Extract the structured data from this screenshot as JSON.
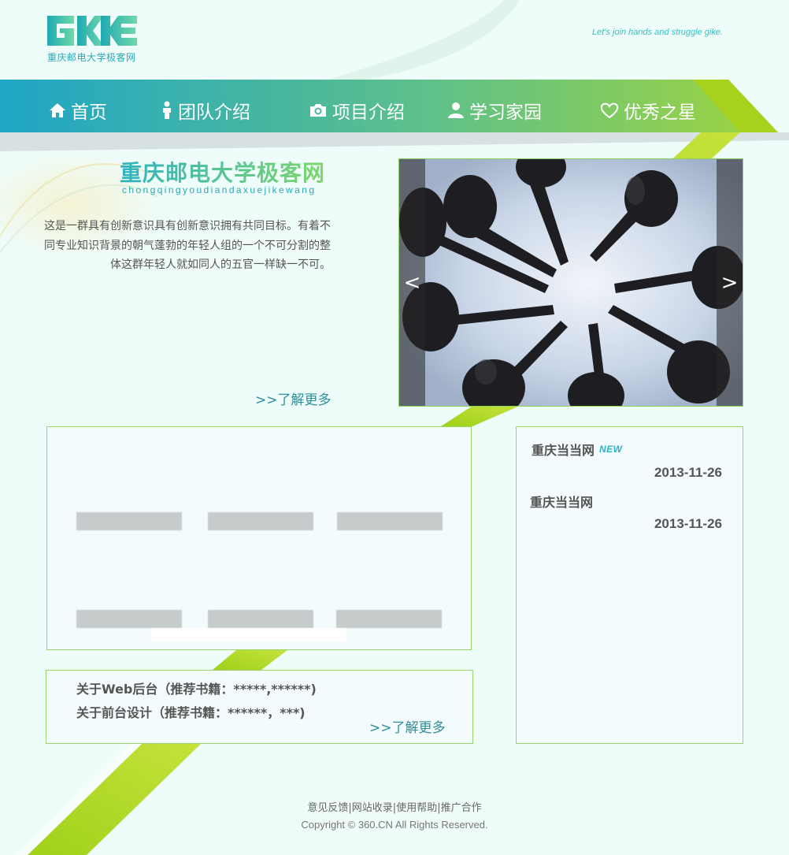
{
  "header": {
    "logo_text": "GKE",
    "logo_subtitle": "重庆邮电大学极客网",
    "slogan": "Let's join hands and struggle gike."
  },
  "nav": {
    "items": [
      {
        "label": "首页",
        "icon": "home-icon"
      },
      {
        "label": "团队介绍",
        "icon": "person-icon"
      },
      {
        "label": "项目介绍",
        "icon": "camera-icon"
      },
      {
        "label": "学习家园",
        "icon": "user-icon"
      },
      {
        "label": "优秀之星",
        "icon": "heart-icon"
      }
    ]
  },
  "hero": {
    "title": "重庆邮电大学极客网",
    "pinyin": "chongqingyoudiandaxuejikewang",
    "description": "这是一群具有创新意识具有创新意识拥有共同目标。有着不同专业知识背景的朝气蓬勃的年轻人组的一个不可分割的整体这群年轻人就如同人的五官一样缺一不可。",
    "more_link": ">>了解更多"
  },
  "slider": {
    "prev": "<",
    "next": ">"
  },
  "books": {
    "lines": [
      "关于Web后台（推荐书籍：*****,******)",
      "关于前台设计（推荐书籍：******，***)"
    ],
    "more_link": ">>了解更多"
  },
  "news": {
    "items": [
      {
        "title": "重庆当当网",
        "badge": "NEW",
        "date": "2013-11-26"
      },
      {
        "title": "重庆当当网",
        "badge": "",
        "date": "2013-11-26"
      }
    ]
  },
  "footer": {
    "links": [
      "意见反馈",
      "网站收录",
      "使用帮助",
      "推广合作"
    ],
    "separator": "|",
    "copyright": "Copyright © 360.CN All Rights Reserved."
  },
  "colors": {
    "nav_start": "#1fa7c4",
    "nav_end": "#8fd24e",
    "accent_green": "#a6d21e",
    "link_teal": "#2d8f9a"
  }
}
